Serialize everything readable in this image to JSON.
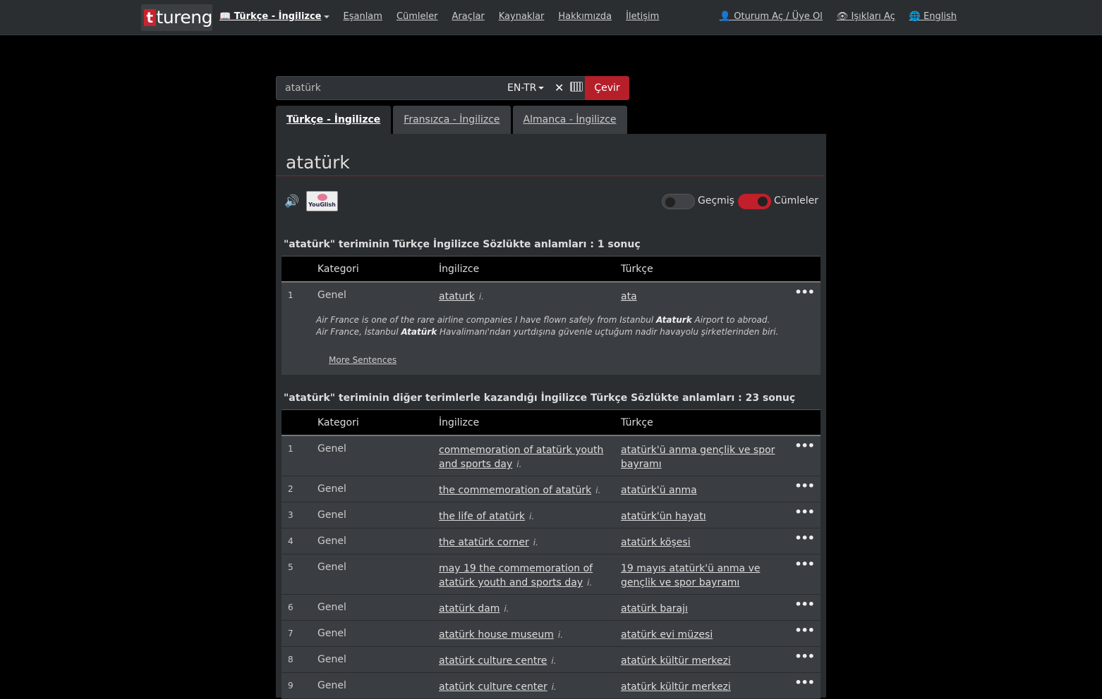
{
  "navbar": {
    "logo_text": "tureng",
    "logo_letter": "t",
    "items": [
      {
        "label": "Türkçe - İngilizce",
        "active": true
      },
      {
        "label": "Eşanlam"
      },
      {
        "label": "Cümleler"
      },
      {
        "label": "Araçlar"
      },
      {
        "label": "Kaynaklar"
      },
      {
        "label": "Hakkımızda"
      },
      {
        "label": "İletişim"
      }
    ],
    "right": {
      "login": "Oturum Aç / Üye Ol",
      "lights": "Işıkları Aç",
      "language": "English"
    }
  },
  "search": {
    "value": "atatürk",
    "lang": "EN-TR",
    "submit": "Çevir"
  },
  "tabs": [
    {
      "label": "Türkçe - İngilizce",
      "active": true
    },
    {
      "label": "Fransızca - İngilizce"
    },
    {
      "label": "Almanca - İngilizce"
    }
  ],
  "result": {
    "word": "atatürk",
    "toggle_history": "Geçmiş",
    "toggle_sentences": "Cümleler",
    "youglish": "YouGlish"
  },
  "table_headers": {
    "category": "Kategori",
    "english": "İngilizce",
    "turkish": "Türkçe"
  },
  "section1": {
    "heading": "\"atatürk\" teriminin Türkçe İngilizce Sözlükte anlamları : 1 sonuç",
    "rows": [
      {
        "num": "1",
        "category": "Genel",
        "english": "ataturk",
        "pos": "i.",
        "turkish": "ata"
      }
    ],
    "example_en_a": "Air France is one of the rare airline companies I have flown safely from Istanbul ",
    "example_en_b": "Ataturk",
    "example_en_c": " Airport to abroad.",
    "example_tr_a": "Air France, İstanbul ",
    "example_tr_b": "Atatürk",
    "example_tr_c": " Havalimanı'ndan yurtdışına güvenle uçtuğum nadir havayolu şirketlerinden biri.",
    "more": "More Sentences"
  },
  "section2": {
    "heading": "\"atatürk\" teriminin diğer terimlerle kazandığı İngilizce Türkçe Sözlükte anlamları : 23 sonuç",
    "rows": [
      {
        "num": "1",
        "category": "Genel",
        "english": "commemoration of atatürk youth and sports day",
        "pos": "i.",
        "turkish": "atatürk'ü anma gençlik ve spor bayramı"
      },
      {
        "num": "2",
        "category": "Genel",
        "english": "the commemoration of atatürk",
        "pos": "i.",
        "turkish": "atatürk'ü anma"
      },
      {
        "num": "3",
        "category": "Genel",
        "english": "the life of atatürk",
        "pos": "i.",
        "turkish": "atatürk'ün hayatı"
      },
      {
        "num": "4",
        "category": "Genel",
        "english": "the atatürk corner",
        "pos": "i.",
        "turkish": "atatürk köşesi"
      },
      {
        "num": "5",
        "category": "Genel",
        "english": "may 19 the commemoration of atatürk youth and sports day",
        "pos": "i.",
        "turkish": "19 mayıs atatürk'ü anma ve gençlik ve spor bayramı"
      },
      {
        "num": "6",
        "category": "Genel",
        "english": "atatürk dam",
        "pos": "i.",
        "turkish": "atatürk barajı"
      },
      {
        "num": "7",
        "category": "Genel",
        "english": "atatürk house museum",
        "pos": "i.",
        "turkish": "atatürk evi müzesi"
      },
      {
        "num": "8",
        "category": "Genel",
        "english": "atatürk culture centre",
        "pos": "i.",
        "turkish": "atatürk kültür merkezi"
      },
      {
        "num": "9",
        "category": "Genel",
        "english": "atatürk culture center",
        "pos": "i.",
        "turkish": "atatürk kültür merkezi"
      }
    ]
  }
}
